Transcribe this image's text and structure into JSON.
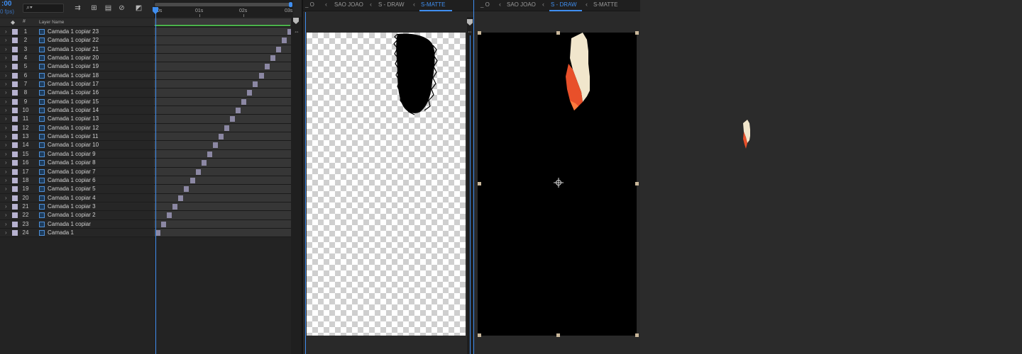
{
  "timeline": {
    "timecode": ":00",
    "timecode_sub": "0 fps)",
    "search_glyph": "⌕▾",
    "ruler_ticks": [
      "0s",
      "01s",
      "02s",
      "03s"
    ],
    "columns": {
      "tag": "◆",
      "number": "#",
      "layer_name": "Layer Name"
    },
    "label_color": "#b7b2d0",
    "clip_color": "#8c88a4",
    "accent": "#3f8ef0",
    "layers": [
      {
        "n": "1",
        "name": "Camada 1 copiar 23"
      },
      {
        "n": "2",
        "name": "Camada 1 copiar 22"
      },
      {
        "n": "3",
        "name": "Camada 1 copiar 21"
      },
      {
        "n": "4",
        "name": "Camada 1 copiar 20"
      },
      {
        "n": "5",
        "name": "Camada 1 copiar 19"
      },
      {
        "n": "6",
        "name": "Camada 1 copiar 18"
      },
      {
        "n": "7",
        "name": "Camada 1 copiar 17"
      },
      {
        "n": "8",
        "name": "Camada 1 copiar 16"
      },
      {
        "n": "9",
        "name": "Camada 1 copiar 15"
      },
      {
        "n": "10",
        "name": "Camada 1 copiar 14"
      },
      {
        "n": "11",
        "name": "Camada 1 copiar 13"
      },
      {
        "n": "12",
        "name": "Camada 1 copiar 12"
      },
      {
        "n": "13",
        "name": "Camada 1 copiar 11"
      },
      {
        "n": "14",
        "name": "Camada 1 copiar 10"
      },
      {
        "n": "15",
        "name": "Camada 1 copiar 9"
      },
      {
        "n": "16",
        "name": "Camada 1 copiar 8"
      },
      {
        "n": "17",
        "name": "Camada 1 copiar 7"
      },
      {
        "n": "18",
        "name": "Camada 1 copiar 6"
      },
      {
        "n": "19",
        "name": "Camada 1 copiar 5"
      },
      {
        "n": "20",
        "name": "Camada 1 copiar 4"
      },
      {
        "n": "21",
        "name": "Camada 1 copiar 3"
      },
      {
        "n": "22",
        "name": "Camada 1 copiar 2"
      },
      {
        "n": "23",
        "name": "Camada 1 copiar"
      },
      {
        "n": "24",
        "name": "Camada 1"
      }
    ]
  },
  "viewer_left": {
    "tabs": {
      "lead": "_ O",
      "tab1": "SAO JOAO",
      "tab2": "S - DRAW",
      "tab3": "S-MATTE"
    },
    "active_tab": "S-MATTE"
  },
  "viewer_right": {
    "tabs": {
      "lead": "_ O",
      "tab1": "SAO JOAO",
      "tab2": "S - DRAW",
      "tab3": "S-MATTE"
    },
    "active_tab": "S - DRAW"
  },
  "icons": {
    "layer_twirl": "chevron-right-icon",
    "layer_source": "composition-icon",
    "anchor": "anchor-point-icon"
  }
}
